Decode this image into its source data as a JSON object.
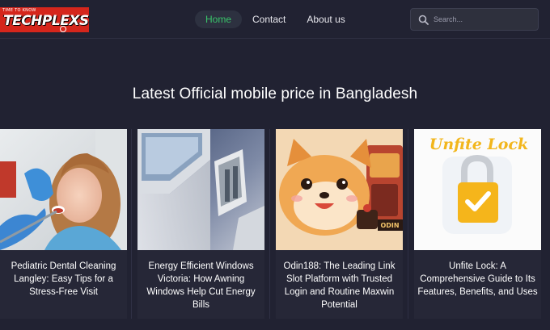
{
  "logo": {
    "tagline": "TIME TO KNOW",
    "wordmark": "TECHPLEXS"
  },
  "nav": {
    "items": [
      {
        "label": "Home",
        "active": true
      },
      {
        "label": "Contact",
        "active": false
      },
      {
        "label": "About us",
        "active": false
      }
    ]
  },
  "search": {
    "placeholder": "Search...",
    "icon": "search-icon"
  },
  "section": {
    "title": "Latest Official mobile price in Bangladesh"
  },
  "posts": [
    {
      "title": "Pediatric Dental Cleaning Langley: Easy Tips for a Stress-Free Visit",
      "image": "dentist-child-photo"
    },
    {
      "title": "Energy Efficient Windows Victoria: How Awning Windows Help Cut Energy Bills",
      "image": "window-frame-photo"
    },
    {
      "title": "Odin188: The Leading Link Slot Platform with Trusted Login and Routine Maxwin Potential",
      "image": "cartoon-dog-illustration"
    },
    {
      "title": "Unfite Lock: A Comprehensive Guide to Its Features, Benefits, and Uses",
      "image": "padlock-illustration",
      "image_caption": "Unfite Lock"
    }
  ],
  "colors": {
    "background": "#212232",
    "accent": "#39c56a",
    "logo_red": "#d5261c"
  }
}
